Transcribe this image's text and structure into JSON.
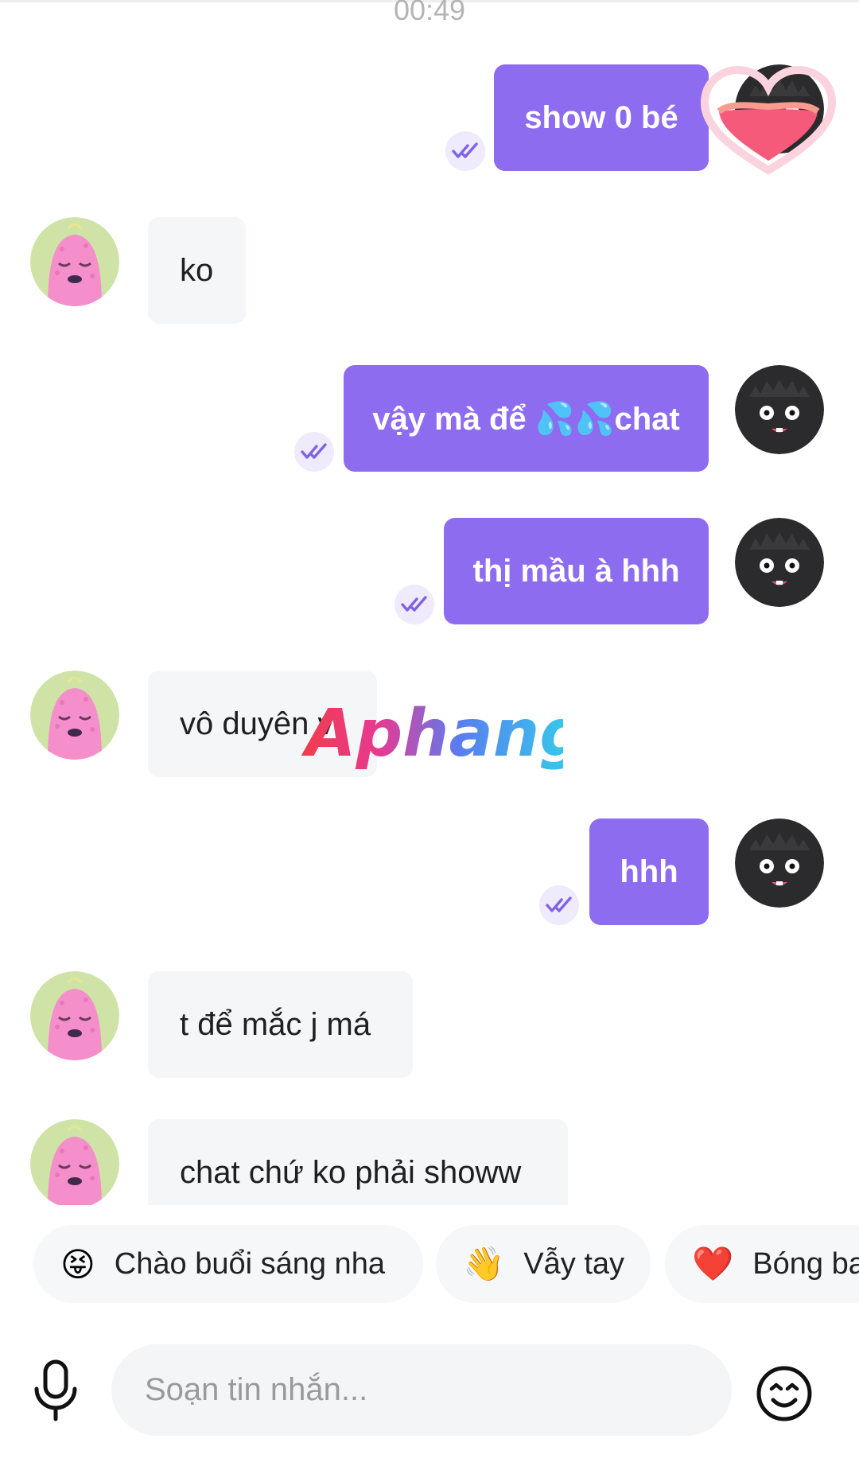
{
  "timestamp": "00:49",
  "messages": [
    {
      "direction": "out",
      "text": "show 0 bé",
      "read": true,
      "sticker": "heart-sticker"
    },
    {
      "direction": "in",
      "text": "ko"
    },
    {
      "direction": "out",
      "text": "vậy mà để 💦💦chat",
      "read": true
    },
    {
      "direction": "out",
      "text": "thị mầu à hhh",
      "read": true
    },
    {
      "direction": "in",
      "text": "vô duyên vl"
    },
    {
      "direction": "out",
      "text": "hhh",
      "read": true
    },
    {
      "direction": "in",
      "text": "t để mắc j má"
    },
    {
      "direction": "in",
      "text": "chat chứ ko phải showw"
    }
  ],
  "watermark": "Aphang",
  "quick_replies": [
    {
      "emoji": "😝",
      "label": "Chào buổi sáng nha"
    },
    {
      "emoji": "👋",
      "label": "Vẫy tay"
    },
    {
      "emoji": "❤️",
      "label": "Bóng bay"
    }
  ],
  "composer": {
    "placeholder": "Soạn tin nhắn..."
  },
  "icons": {
    "read_receipt": "double-check-icon",
    "mic": "microphone-icon",
    "emoji": "smiley-icon",
    "sender_avatar": "black-furry-monster-avatar",
    "contact_avatar": "pink-monster-avatar"
  },
  "colors": {
    "outgoing_bubble": "#8e6cf0",
    "incoming_bubble": "#f5f6f8",
    "read_receipt_bg": "#efeafc"
  }
}
